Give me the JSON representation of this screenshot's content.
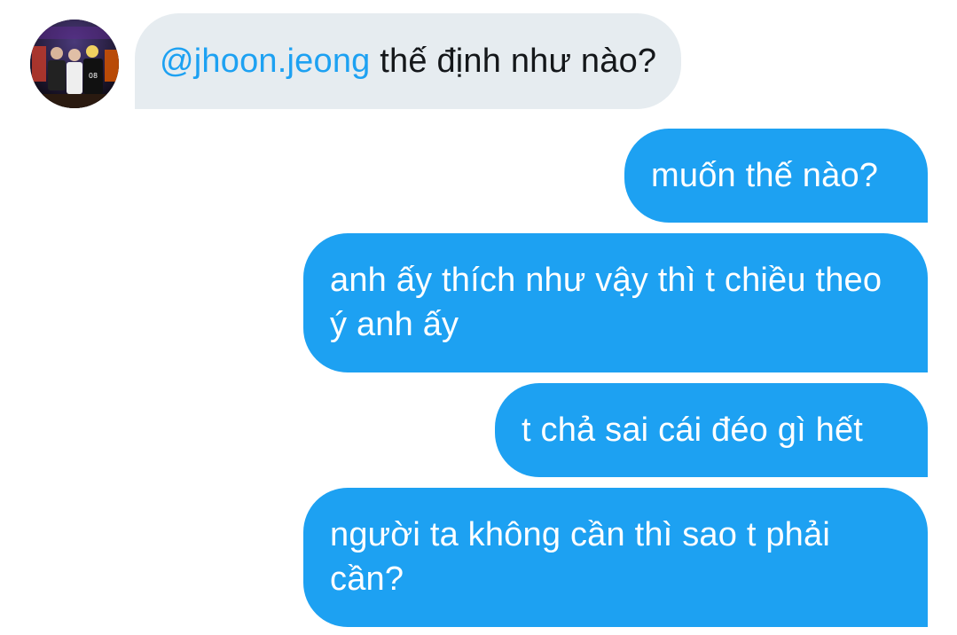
{
  "conversation": {
    "incoming": {
      "mention": "@jhoon.jeong",
      "text": " thế định như nào?"
    },
    "outgoing": [
      "muốn thế nào?",
      "anh ấy thích như vậy thì t chiều theo ý anh ấy",
      "t chả sai cái đéo gì hết",
      "người ta không cần thì sao t phải cần?"
    ]
  },
  "colors": {
    "incoming_bg": "#e6ecf0",
    "outgoing_bg": "#1da1f2",
    "mention": "#1da1f2"
  }
}
